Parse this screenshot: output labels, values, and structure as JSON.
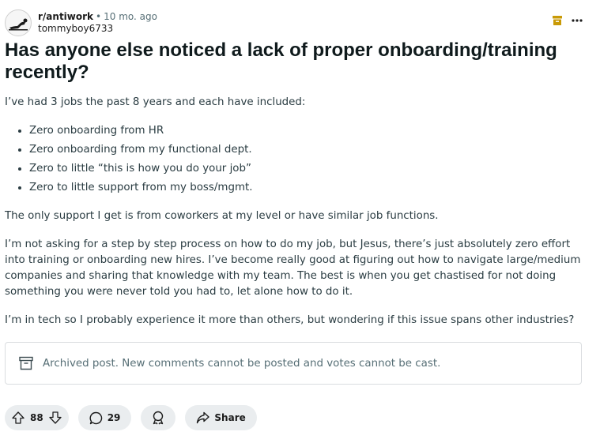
{
  "post": {
    "subreddit": "r/antiwork",
    "separator": "•",
    "time": "10 mo. ago",
    "author": "tommyboy6733",
    "title": "Has anyone else noticed a lack of proper onboarding/training recently?",
    "intro": "I’ve had 3 jobs the past 8 years and each have included:",
    "bullets": [
      "Zero onboarding from HR",
      "Zero onboarding from my functional dept.",
      "Zero to little “this is how you do your job”",
      "Zero to little support from my boss/mgmt."
    ],
    "paragraph2": "The only support I get is from coworkers at my level or have similar job functions.",
    "paragraph3": "I’m not asking for a step by step process on how to do my job, but Jesus, there’s just absolutely zero effort into training or onboarding new hires. I’ve become really good at figuring out how to navigate large/medium companies and sharing that knowledge with my team. The best is when you get chastised for not doing something you were never told you had to, let alone how to do it.",
    "paragraph4": "I’m in tech so I probably experience it more than others, but wondering if this issue spans other industries?"
  },
  "archived": {
    "text": "Archived post. New comments cannot be posted and votes cannot be cast."
  },
  "actions": {
    "votes": "88",
    "comments": "29",
    "share": "Share"
  },
  "icons": {
    "avatar": "subreddit-avatar-icon",
    "archive_badge": "archive-icon",
    "more": "more-options-icon",
    "upvote": "upvote-icon",
    "downvote": "downvote-icon",
    "comment": "comment-icon",
    "award": "award-icon",
    "share": "share-icon"
  },
  "colors": {
    "archive_badge": "#c99a06",
    "pill_bg": "#eaedef",
    "muted_text": "#576f76"
  }
}
